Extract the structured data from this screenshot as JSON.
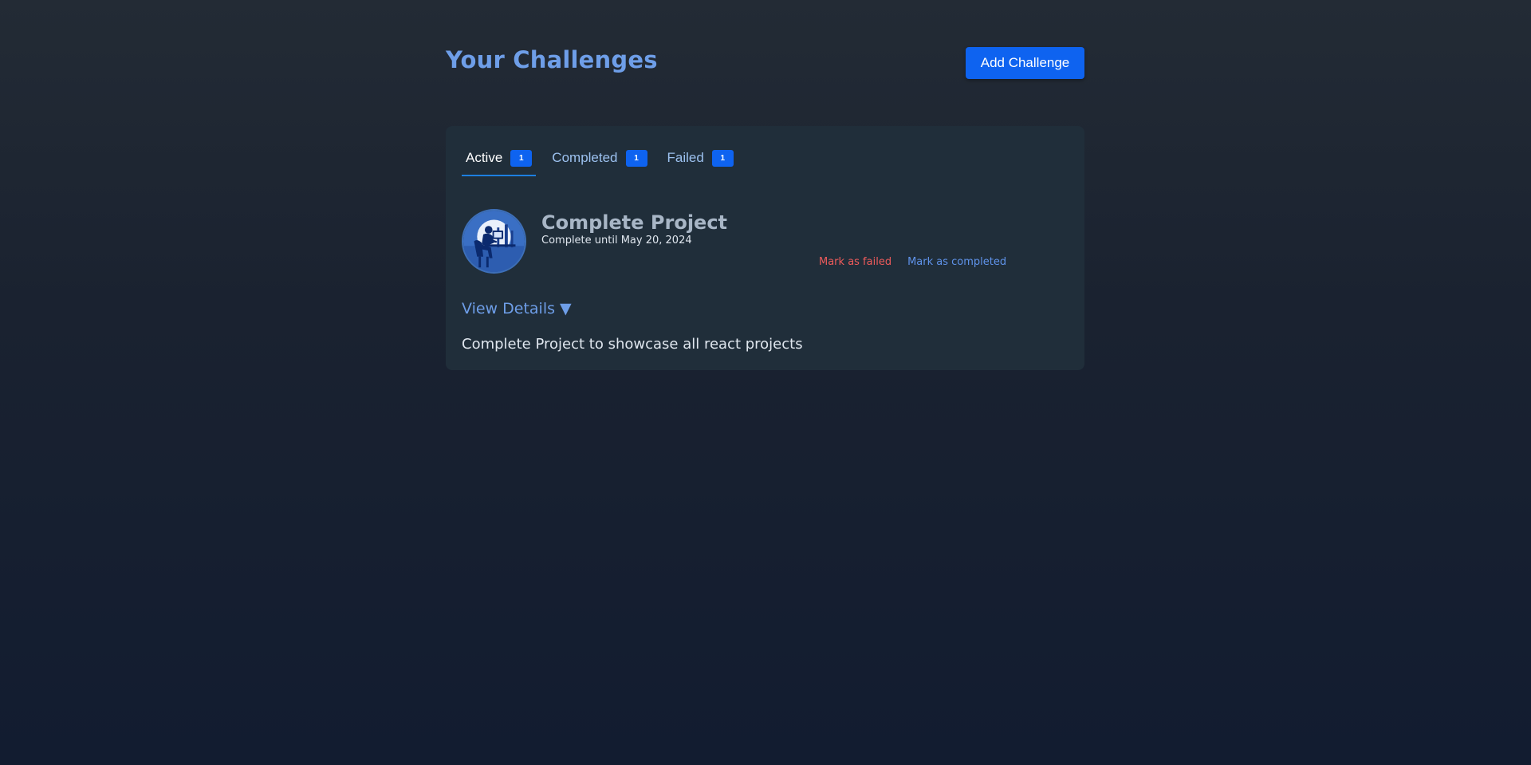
{
  "header": {
    "title": "Your Challenges",
    "add_button_label": "Add Challenge"
  },
  "tabs": [
    {
      "label": "Active",
      "count": "1",
      "active": true
    },
    {
      "label": "Completed",
      "count": "1",
      "active": false
    },
    {
      "label": "Failed",
      "count": "1",
      "active": false
    }
  ],
  "challenge": {
    "title": "Complete Project",
    "deadline": "Complete until May 20, 2024",
    "image_icon": "person-at-desk-illustration",
    "mark_failed_label": "Mark as failed",
    "mark_completed_label": "Mark as completed",
    "details_toggle_label": "View Details ▼",
    "description": "Complete Project to showcase all react projects"
  },
  "colors": {
    "accent": "#0e63f0",
    "title": "#6e9ee8",
    "danger": "#ee5b5b",
    "card_bg": "#202e3a"
  }
}
